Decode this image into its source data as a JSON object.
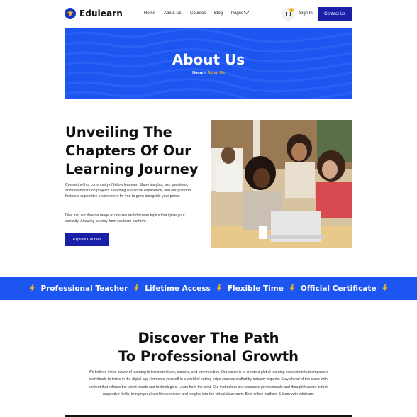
{
  "brand": {
    "name": "Edulearn"
  },
  "nav": {
    "items": [
      "Home",
      "About Us",
      "Courses",
      "Blog",
      "Pages"
    ],
    "sign_in": "Sign In",
    "contact": "Contact Us"
  },
  "banner": {
    "title": "About Us",
    "breadcrumb_home": "Home",
    "breadcrumb_sep": ">",
    "breadcrumb_current": "About Us"
  },
  "intro": {
    "title": "Unveiling The Chapters Of Our Learning Journey",
    "p1": "Connect with a community of fellow learners. Share insights, ask questions, and collaborate on projects. Learning is a social experience, and our platform fosters a supportive environment for you to grow alongside your peers.",
    "p2": "Dive into our diverse range of courses and discover topics that ignite your curiosity. Amazing journey from edulearn platform.",
    "button": "Explore Courses"
  },
  "features": [
    "Professional Teacher",
    "Lifetime Access",
    "Flexible Time",
    "Official Certificate"
  ],
  "discover": {
    "title_line1": "Discover The Path",
    "title_line2": "To Professional Growth",
    "text": "We believe in the power of learning to transform lives, careers, and communities. Our vision is to create a global learning ecosystem that empowers individuals to thrive in the digital age. Immerse yourself in a world of cutting-edge courses crafted by industry experts. Stay ahead of the curve with content that reflects the latest trends and technologies. Learn from the best. Our instructors are seasoned professionals and thought leaders in their respective fields, bringing real-world experience and insights into the virtual classroom. Best online platform & learn with edulearn."
  },
  "colors": {
    "primary": "#1d55f0",
    "dark_blue": "#1a1fa8",
    "accent": "#f5b21a"
  },
  "icons": [
    "graduation-cap-icon",
    "cart-icon",
    "chevron-down-icon",
    "lightning-bolt-icon"
  ]
}
